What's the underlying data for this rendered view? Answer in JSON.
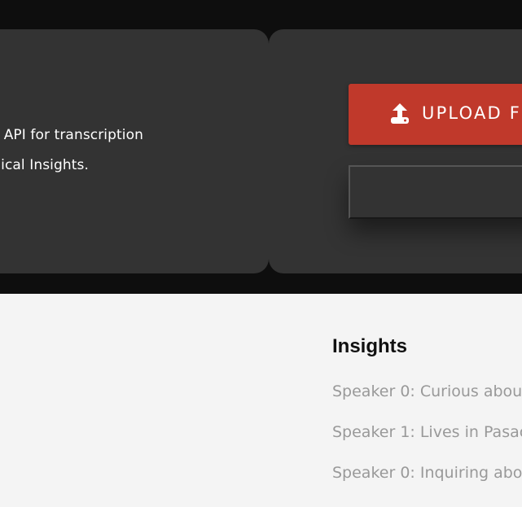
{
  "hero": {
    "description_line_1": "n API for transcription",
    "description_line_2": "gical Insights."
  },
  "upload": {
    "button_label": "UPLOAD FI",
    "icon": "upload-icon",
    "file_input_value": ""
  },
  "insights": {
    "title": "Insights",
    "items": [
      "Speaker 0: Curious abou",
      "Speaker 1: Lives in Pasac",
      "Speaker 0: Inquiring abo"
    ]
  },
  "colors": {
    "page_background": "#f4f4f4",
    "dark_band": "#0e0e0e",
    "panel": "#333333",
    "accent": "#c0392b",
    "insight_text": "#999999"
  }
}
